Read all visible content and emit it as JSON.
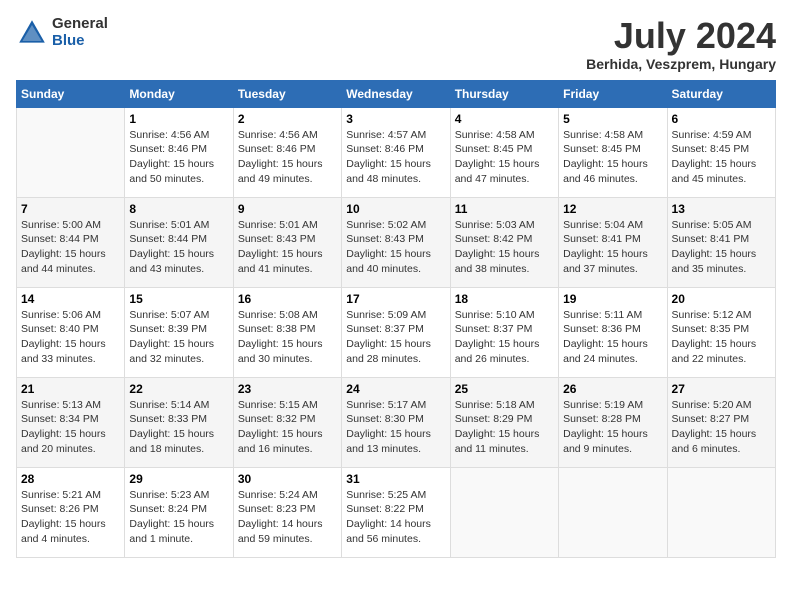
{
  "header": {
    "logo_general": "General",
    "logo_blue": "Blue",
    "month_title": "July 2024",
    "location": "Berhida, Veszprem, Hungary"
  },
  "weekdays": [
    "Sunday",
    "Monday",
    "Tuesday",
    "Wednesday",
    "Thursday",
    "Friday",
    "Saturday"
  ],
  "weeks": [
    [
      {
        "day": "",
        "info": ""
      },
      {
        "day": "1",
        "info": "Sunrise: 4:56 AM\nSunset: 8:46 PM\nDaylight: 15 hours\nand 50 minutes."
      },
      {
        "day": "2",
        "info": "Sunrise: 4:56 AM\nSunset: 8:46 PM\nDaylight: 15 hours\nand 49 minutes."
      },
      {
        "day": "3",
        "info": "Sunrise: 4:57 AM\nSunset: 8:46 PM\nDaylight: 15 hours\nand 48 minutes."
      },
      {
        "day": "4",
        "info": "Sunrise: 4:58 AM\nSunset: 8:45 PM\nDaylight: 15 hours\nand 47 minutes."
      },
      {
        "day": "5",
        "info": "Sunrise: 4:58 AM\nSunset: 8:45 PM\nDaylight: 15 hours\nand 46 minutes."
      },
      {
        "day": "6",
        "info": "Sunrise: 4:59 AM\nSunset: 8:45 PM\nDaylight: 15 hours\nand 45 minutes."
      }
    ],
    [
      {
        "day": "7",
        "info": "Sunrise: 5:00 AM\nSunset: 8:44 PM\nDaylight: 15 hours\nand 44 minutes."
      },
      {
        "day": "8",
        "info": "Sunrise: 5:01 AM\nSunset: 8:44 PM\nDaylight: 15 hours\nand 43 minutes."
      },
      {
        "day": "9",
        "info": "Sunrise: 5:01 AM\nSunset: 8:43 PM\nDaylight: 15 hours\nand 41 minutes."
      },
      {
        "day": "10",
        "info": "Sunrise: 5:02 AM\nSunset: 8:43 PM\nDaylight: 15 hours\nand 40 minutes."
      },
      {
        "day": "11",
        "info": "Sunrise: 5:03 AM\nSunset: 8:42 PM\nDaylight: 15 hours\nand 38 minutes."
      },
      {
        "day": "12",
        "info": "Sunrise: 5:04 AM\nSunset: 8:41 PM\nDaylight: 15 hours\nand 37 minutes."
      },
      {
        "day": "13",
        "info": "Sunrise: 5:05 AM\nSunset: 8:41 PM\nDaylight: 15 hours\nand 35 minutes."
      }
    ],
    [
      {
        "day": "14",
        "info": "Sunrise: 5:06 AM\nSunset: 8:40 PM\nDaylight: 15 hours\nand 33 minutes."
      },
      {
        "day": "15",
        "info": "Sunrise: 5:07 AM\nSunset: 8:39 PM\nDaylight: 15 hours\nand 32 minutes."
      },
      {
        "day": "16",
        "info": "Sunrise: 5:08 AM\nSunset: 8:38 PM\nDaylight: 15 hours\nand 30 minutes."
      },
      {
        "day": "17",
        "info": "Sunrise: 5:09 AM\nSunset: 8:37 PM\nDaylight: 15 hours\nand 28 minutes."
      },
      {
        "day": "18",
        "info": "Sunrise: 5:10 AM\nSunset: 8:37 PM\nDaylight: 15 hours\nand 26 minutes."
      },
      {
        "day": "19",
        "info": "Sunrise: 5:11 AM\nSunset: 8:36 PM\nDaylight: 15 hours\nand 24 minutes."
      },
      {
        "day": "20",
        "info": "Sunrise: 5:12 AM\nSunset: 8:35 PM\nDaylight: 15 hours\nand 22 minutes."
      }
    ],
    [
      {
        "day": "21",
        "info": "Sunrise: 5:13 AM\nSunset: 8:34 PM\nDaylight: 15 hours\nand 20 minutes."
      },
      {
        "day": "22",
        "info": "Sunrise: 5:14 AM\nSunset: 8:33 PM\nDaylight: 15 hours\nand 18 minutes."
      },
      {
        "day": "23",
        "info": "Sunrise: 5:15 AM\nSunset: 8:32 PM\nDaylight: 15 hours\nand 16 minutes."
      },
      {
        "day": "24",
        "info": "Sunrise: 5:17 AM\nSunset: 8:30 PM\nDaylight: 15 hours\nand 13 minutes."
      },
      {
        "day": "25",
        "info": "Sunrise: 5:18 AM\nSunset: 8:29 PM\nDaylight: 15 hours\nand 11 minutes."
      },
      {
        "day": "26",
        "info": "Sunrise: 5:19 AM\nSunset: 8:28 PM\nDaylight: 15 hours\nand 9 minutes."
      },
      {
        "day": "27",
        "info": "Sunrise: 5:20 AM\nSunset: 8:27 PM\nDaylight: 15 hours\nand 6 minutes."
      }
    ],
    [
      {
        "day": "28",
        "info": "Sunrise: 5:21 AM\nSunset: 8:26 PM\nDaylight: 15 hours\nand 4 minutes."
      },
      {
        "day": "29",
        "info": "Sunrise: 5:23 AM\nSunset: 8:24 PM\nDaylight: 15 hours\nand 1 minute."
      },
      {
        "day": "30",
        "info": "Sunrise: 5:24 AM\nSunset: 8:23 PM\nDaylight: 14 hours\nand 59 minutes."
      },
      {
        "day": "31",
        "info": "Sunrise: 5:25 AM\nSunset: 8:22 PM\nDaylight: 14 hours\nand 56 minutes."
      },
      {
        "day": "",
        "info": ""
      },
      {
        "day": "",
        "info": ""
      },
      {
        "day": "",
        "info": ""
      }
    ]
  ]
}
